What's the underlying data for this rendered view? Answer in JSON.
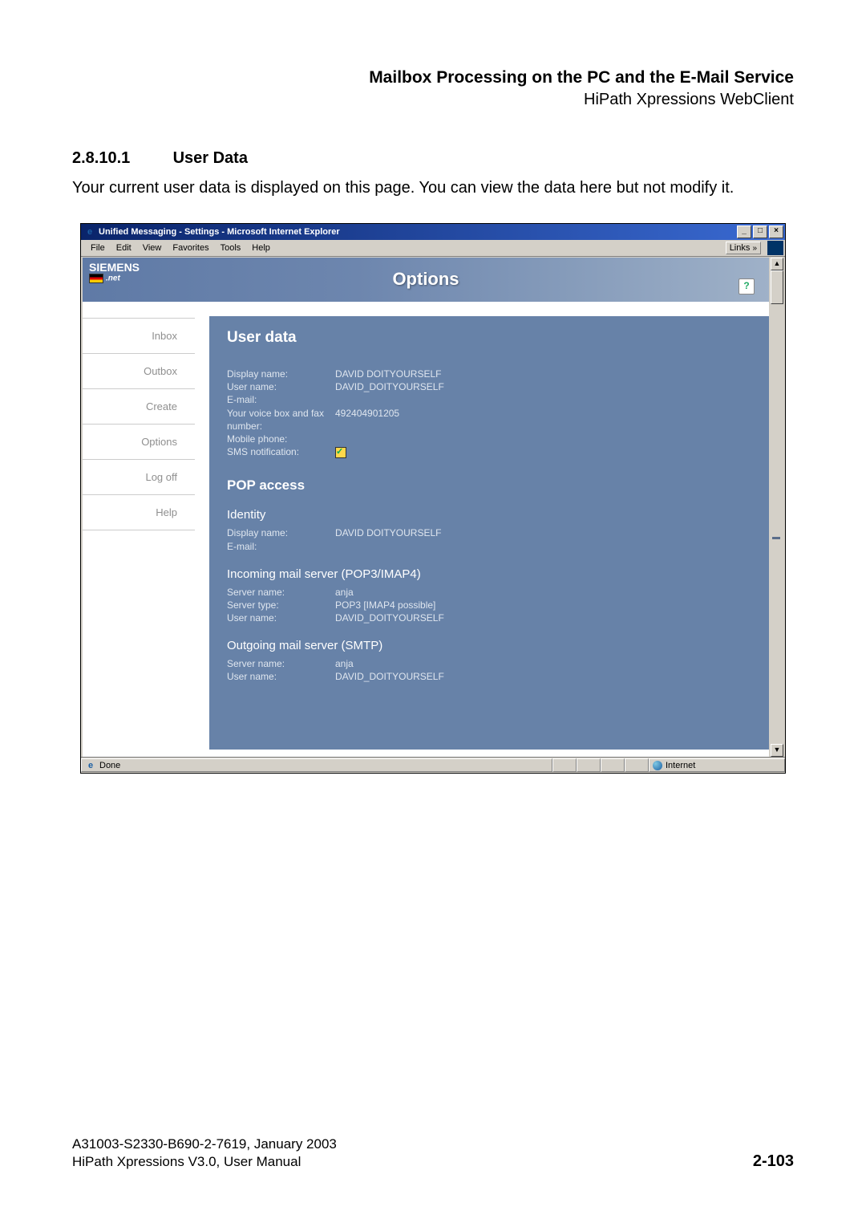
{
  "doc": {
    "title": "Mailbox Processing on the PC and the E-Mail Service",
    "subtitle": "HiPath Xpressions WebClient",
    "section_number": "2.8.10.1",
    "section_name": "User Data",
    "body": "Your current user data is displayed on this page. You can view the data here but not modify it."
  },
  "window": {
    "title": "Unified Messaging - Settings - Microsoft Internet Explorer",
    "menus": [
      "File",
      "Edit",
      "View",
      "Favorites",
      "Tools",
      "Help"
    ],
    "links_label": "Links",
    "win_min": "_",
    "win_max": "□",
    "win_close": "×",
    "status_done": "Done",
    "status_zone": "Internet",
    "scroll_up": "▲",
    "scroll_down": "▼"
  },
  "banner": {
    "brand": "SIEMENS",
    "brand_sub": ".net",
    "title": "Options",
    "help": "?"
  },
  "nav": {
    "items": [
      "Inbox",
      "Outbox",
      "Create",
      "Options",
      "Log off",
      "Help"
    ]
  },
  "userdata": {
    "heading": "User data",
    "rows": {
      "display_name_k": "Display name:",
      "display_name_v": "DAVID DOITYOURSELF",
      "user_name_k": "User name:",
      "user_name_v": "DAVID_DOITYOURSELF",
      "email_k": "E-mail:",
      "email_v": "",
      "voicefax_k": "Your voice box and fax number:",
      "voicefax_v": "492404901205",
      "mobile_k": "Mobile phone:",
      "mobile_v": "",
      "sms_k": "SMS notification:"
    }
  },
  "pop": {
    "heading": "POP access",
    "identity_h": "Identity",
    "identity": {
      "display_name_k": "Display name:",
      "display_name_v": "DAVID DOITYOURSELF",
      "email_k": "E-mail:",
      "email_v": ""
    },
    "incoming_h": "Incoming mail server (POP3/IMAP4)",
    "incoming": {
      "server_name_k": "Server name:",
      "server_name_v": "anja",
      "server_type_k": "Server type:",
      "server_type_v": "POP3 [IMAP4 possible]",
      "user_name_k": "User name:",
      "user_name_v": "DAVID_DOITYOURSELF"
    },
    "outgoing_h": "Outgoing mail server (SMTP)",
    "outgoing": {
      "server_name_k": "Server name:",
      "server_name_v": "anja",
      "user_name_k": "User name:",
      "user_name_v": "DAVID_DOITYOURSELF"
    }
  },
  "footer": {
    "line1": "A31003-S2330-B690-2-7619, January 2003",
    "line2": "HiPath Xpressions V3.0, User Manual",
    "page": "2-103"
  }
}
